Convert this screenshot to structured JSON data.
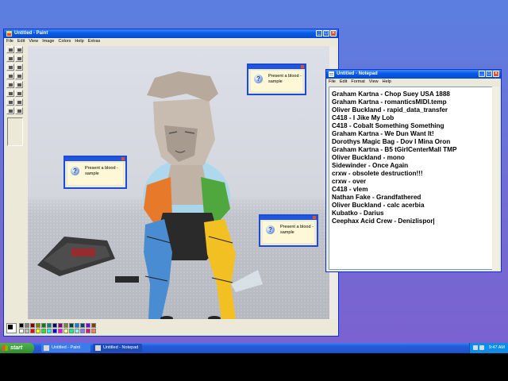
{
  "paint": {
    "title": "Untitled - Paint",
    "menu": [
      "File",
      "Edit",
      "View",
      "Image",
      "Colors",
      "Help",
      "Extras"
    ],
    "palette_colors": [
      "#000000",
      "#808080",
      "#800000",
      "#808000",
      "#008000",
      "#008080",
      "#000080",
      "#800080",
      "#808040",
      "#004040",
      "#0080ff",
      "#004080",
      "#8000ff",
      "#804000",
      "#ffffff",
      "#c0c0c0",
      "#ff0000",
      "#ffff00",
      "#00ff00",
      "#00ffff",
      "#0000ff",
      "#ff00ff",
      "#ffff80",
      "#00ff80",
      "#80ffff",
      "#8080ff",
      "#ff0080",
      "#ff8040"
    ]
  },
  "notepad": {
    "title": "Untitled - Notepad",
    "menu": [
      "File",
      "Edit",
      "Format",
      "View",
      "Help"
    ],
    "lines": [
      "Graham Kartna - Chop Suey USA 1888",
      "Graham Kartna - romanticsMIDI.temp",
      "Oliver Buckland - rapid_data_transfer",
      "C418 - I Jike My Lob",
      "C418 - Cobalt Something Something",
      "Graham Kartna - We Dun Want It!",
      "Dorothys Magic Bag - Dov I Mina Oron",
      "Graham Kartna - B5 tGirlCenterMall TMP",
      "Oliver Buckland - mono",
      "Sidewinder - Once Again",
      "crxw - obsolete destruction!!!",
      "crxw - over",
      "C418 - vlem",
      "Nathan Fake - Grandfathered",
      "Oliver Buckland - calc acerbia",
      "Kubatko - Darius",
      "Ceephax Acid Crew - Denizlispor"
    ]
  },
  "popups": [
    {
      "text": "Present a blood - sample"
    },
    {
      "text": "Present a blood - sample"
    },
    {
      "text": "Present a blood - sample"
    }
  ],
  "taskbar": {
    "start_label": "start",
    "tasks": [
      "Untitled - Paint",
      "Untitled - Notepad"
    ],
    "clock": "9:47 AM"
  },
  "colors": {
    "xp_blue": "#0a5ce6",
    "start_green": "#2f8e2f",
    "desktop": "#6f6fd6"
  }
}
